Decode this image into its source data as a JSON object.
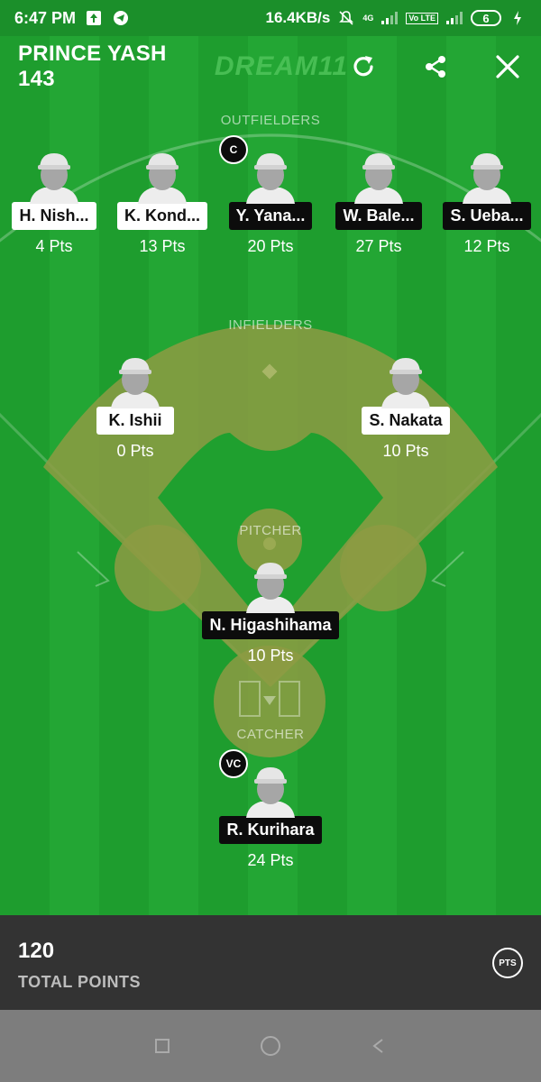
{
  "status_bar": {
    "time": "6:47 PM",
    "network_speed": "16.4KB/s",
    "network_type": "4G",
    "volte": "Vo LTE",
    "battery_level": "6"
  },
  "header": {
    "team_name": "PRINCE YASH 143",
    "brand": "DREAM11"
  },
  "sections": {
    "outfielders": "OUTFIELDERS",
    "infielders": "INFIELDERS",
    "pitcher": "PITCHER",
    "catcher": "CATCHER"
  },
  "players": [
    {
      "name": "H. Nish...",
      "points": "4 Pts",
      "tag_style": "light",
      "badge": ""
    },
    {
      "name": "K. Kond...",
      "points": "13 Pts",
      "tag_style": "light",
      "badge": ""
    },
    {
      "name": "Y. Yana...",
      "points": "20 Pts",
      "tag_style": "dark",
      "badge": "C"
    },
    {
      "name": "W. Bale...",
      "points": "27 Pts",
      "tag_style": "dark",
      "badge": ""
    },
    {
      "name": "S. Ueba...",
      "points": "12 Pts",
      "tag_style": "dark",
      "badge": ""
    },
    {
      "name": "K. Ishii",
      "points": "0 Pts",
      "tag_style": "light",
      "badge": ""
    },
    {
      "name": "S. Nakata",
      "points": "10 Pts",
      "tag_style": "light",
      "badge": ""
    },
    {
      "name": "N. Higashihama",
      "points": "10 Pts",
      "tag_style": "dark",
      "badge": ""
    },
    {
      "name": "R. Kurihara",
      "points": "24 Pts",
      "tag_style": "dark",
      "badge": "VC"
    }
  ],
  "footer": {
    "total_points": "120",
    "total_label": "TOTAL POINTS",
    "pts_button": "PTS"
  },
  "icons": {
    "refresh": "refresh-icon",
    "share": "share-icon",
    "close": "close-icon"
  },
  "colors": {
    "field_green": "#1e9d2e",
    "infield_dirt": "#8a9a3c",
    "footer_bg": "#333333"
  }
}
